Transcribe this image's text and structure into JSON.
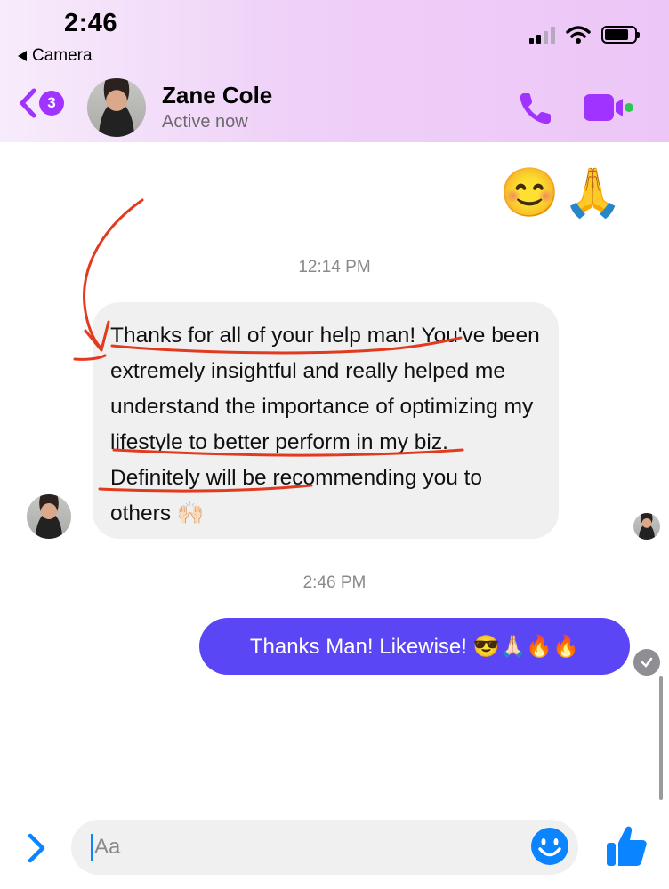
{
  "status_bar": {
    "time": "2:46",
    "back_app": "Camera"
  },
  "header": {
    "unread_count": "3",
    "contact_name": "Zane Cole",
    "contact_status": "Active now"
  },
  "conversation": {
    "reaction_emojis": "😊🙏",
    "timestamp_1": "12:14 PM",
    "incoming_message": "Thanks for all of your help man! You've been extremely insightful and really helped me understand the importance of optimizing my lifestyle to better perform in my biz. Definitely will be recommending you to others 🙌🏻",
    "timestamp_2": "2:46 PM",
    "outgoing_message": "Thanks Man! Likewise! 😎🙏🏻🔥🔥"
  },
  "composer": {
    "placeholder": "Aa"
  },
  "colors": {
    "accent": "#a033ff",
    "outgoing_bubble": "#5b46f5",
    "active_dot": "#2ac84c",
    "annotation": "#e23a1e"
  },
  "icons": [
    "back-chevron-icon",
    "phone-icon",
    "video-camera-icon",
    "chevron-right-icon",
    "smiley-icon",
    "thumbs-up-icon",
    "sent-check-icon"
  ]
}
